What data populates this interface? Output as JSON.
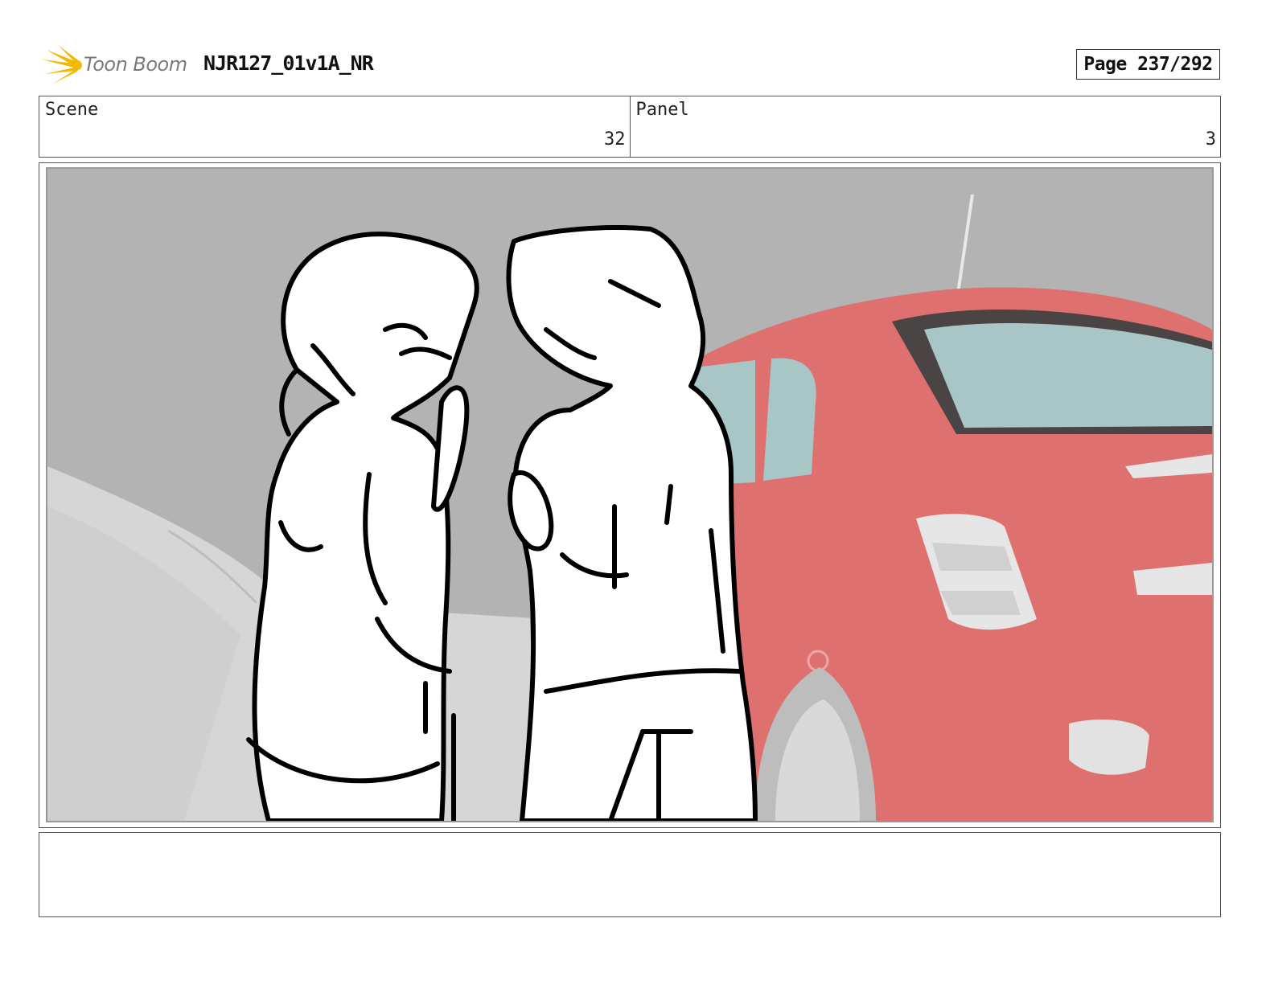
{
  "header": {
    "logo_text": "Toon Boom",
    "project_title": "NJR127_01v1A_NR",
    "page_label": "Page 237/292"
  },
  "info": {
    "scene_label": "Scene",
    "scene_value": "32",
    "panel_label": "Panel",
    "panel_value": "3"
  },
  "panel_image": {
    "content": [
      "two-characters-sketch",
      "red-car-background"
    ]
  },
  "notes": {
    "text": ""
  },
  "colors": {
    "logo_accent": "#f5b800",
    "car_red": "#e07070",
    "car_window": "#a9c6c6",
    "wall_gray": "#b3b3b3"
  }
}
